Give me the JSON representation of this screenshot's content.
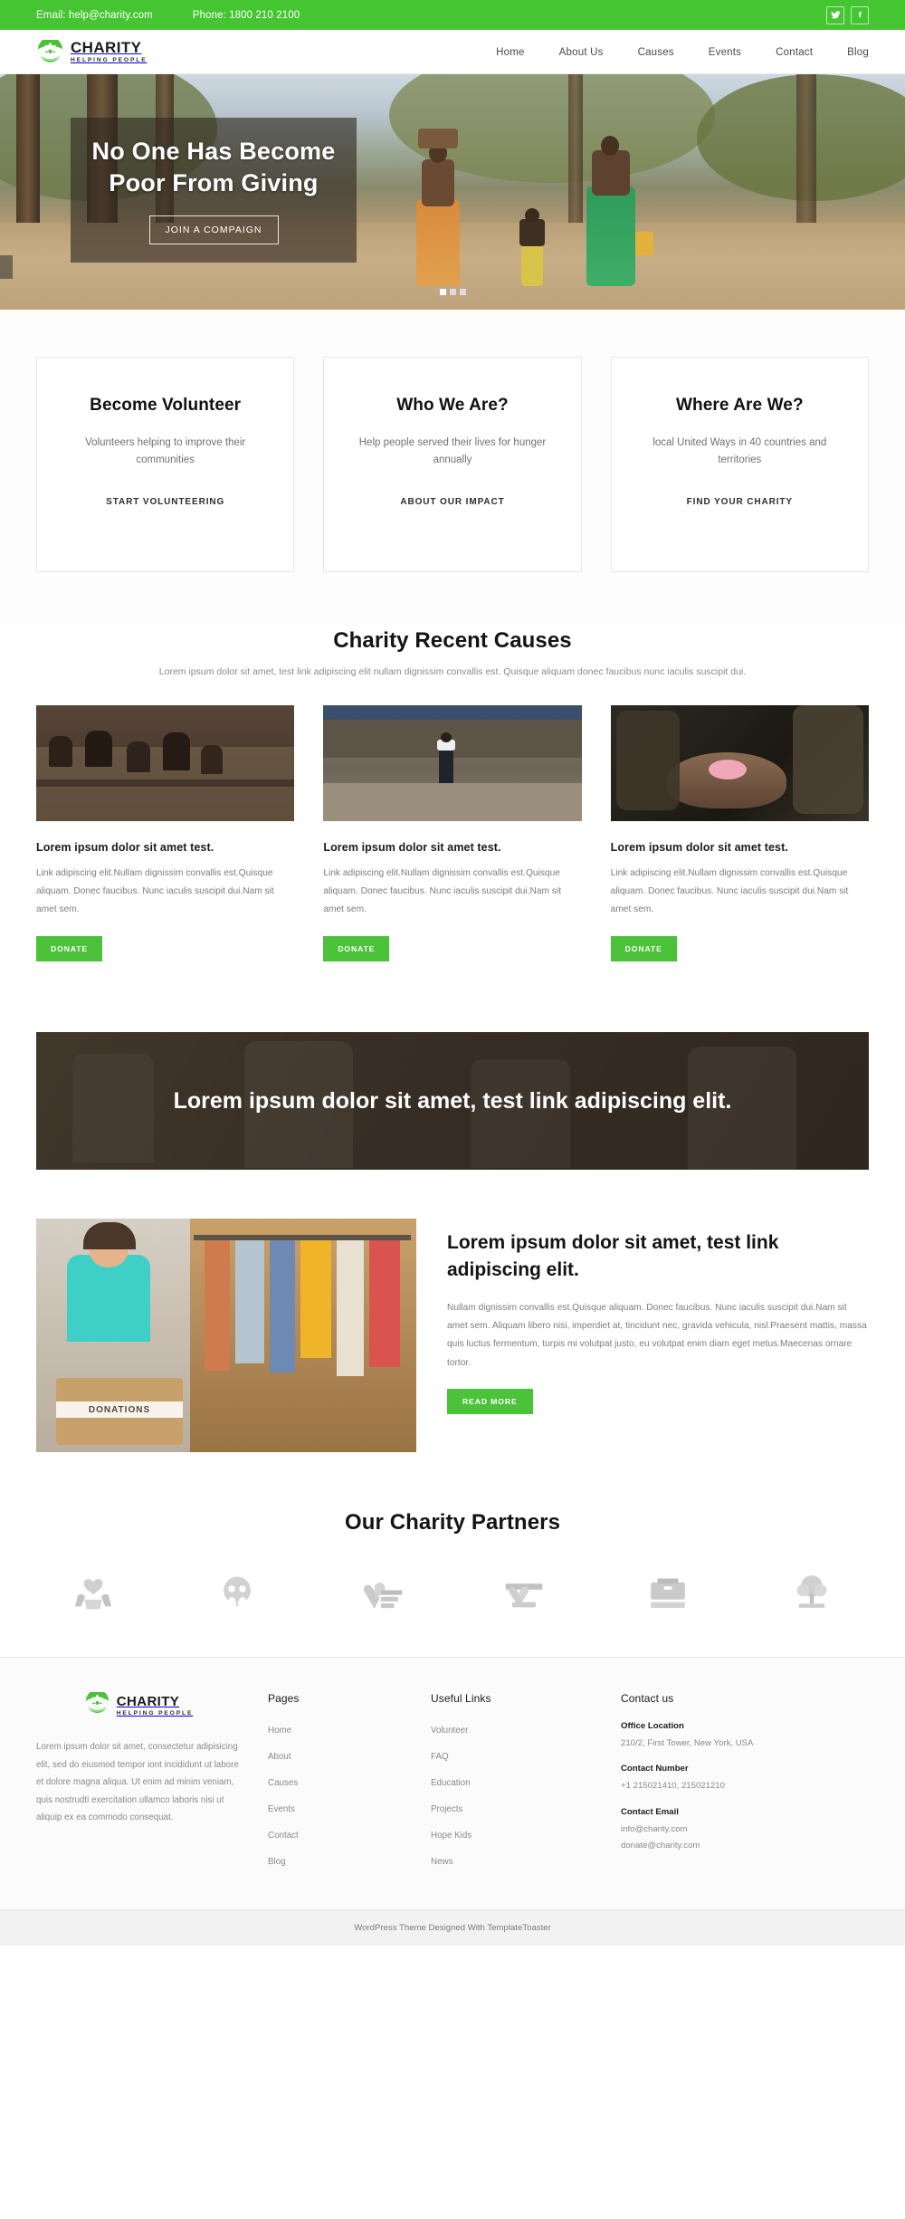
{
  "topbar": {
    "email": "Email: help@charity.com",
    "phone": "Phone: 1800 210 2100",
    "social": [
      {
        "name": "twitter-icon",
        "label": "Twitter"
      },
      {
        "name": "facebook-icon",
        "label": "Facebook"
      }
    ]
  },
  "brand": {
    "title": "CHARITY",
    "subtitle": "HELPING PEOPLE",
    "accent_color": "#4cc13a",
    "dark_color": "#1a1a1a"
  },
  "nav": {
    "items": [
      {
        "label": "Home"
      },
      {
        "label": "About Us"
      },
      {
        "label": "Causes"
      },
      {
        "label": "Events"
      },
      {
        "label": "Contact"
      },
      {
        "label": "Blog"
      }
    ]
  },
  "hero": {
    "headline": "No One Has Become Poor From Giving",
    "button": "JOIN A COMPAIGN",
    "slides": 3,
    "active_slide": 1
  },
  "features": [
    {
      "title": "Become Volunteer",
      "text": "Volunteers helping to improve their communities",
      "link": "START VOLUNTEERING"
    },
    {
      "title": "Who We Are?",
      "text": "Help people served their lives for hunger annually",
      "link": "ABOUT OUR IMPACT"
    },
    {
      "title": "Where Are We?",
      "text": "local United Ways in 40 countries and territories",
      "link": "FIND YOUR CHARITY"
    }
  ],
  "causes_section": {
    "title": "Charity Recent Causes",
    "subtitle": "Lorem ipsum dolor sit amet, test link adipiscing elit nullam dignissim convallis est. Quisque aliquam donec faucibus nunc iaculis suscipit dui.",
    "cards": [
      {
        "title": "Lorem ipsum dolor sit amet test.",
        "text": "Link adipiscing elit.Nullam dignissim convallis est.Quisque aliquam. Donec faucibus. Nunc iaculis suscipit dui.Nam sit amet sem.",
        "button": "DONATE"
      },
      {
        "title": "Lorem ipsum dolor sit amet test.",
        "text": "Link adipiscing elit.Nullam dignissim convallis est.Quisque aliquam. Donec faucibus. Nunc iaculis suscipit dui.Nam sit amet sem.",
        "button": "DONATE"
      },
      {
        "title": "Lorem ipsum dolor sit amet test.",
        "text": "Link adipiscing elit.Nullam dignissim convallis est.Quisque aliquam. Donec faucibus. Nunc iaculis suscipit dui.Nam sit amet sem.",
        "button": "DONATE"
      }
    ]
  },
  "banner": {
    "text": "Lorem ipsum dolor sit amet, test link adipiscing elit."
  },
  "about": {
    "title": "Lorem ipsum dolor sit amet, test link adipiscing elit.",
    "text": "Nullam dignissim convallis est.Quisque aliquam. Donec faucibus. Nunc iaculis suscipit dui.Nam sit amet sem. Aliquam libero nisi, imperdiet at, tincidunt nec, gravida vehicula, nisl.Praesent mattis, massa quis luctus fermentum, turpis mi volutpat justo, eu volutpat enim diam eget metus.Maecenas ornare tortor.",
    "button": "READ MORE",
    "image_caption": "DONATIONS"
  },
  "partners": {
    "title": "Our Charity Partners",
    "logos": [
      {
        "name": "partner-hands-heart-logo",
        "caption": ""
      },
      {
        "name": "partner-family-heart-logo",
        "caption": ""
      },
      {
        "name": "partner-you-can-help-logo",
        "caption": "YOU CAN HELP"
      },
      {
        "name": "partner-you-can-help-hands-logo",
        "caption": "YOU CAN HELP"
      },
      {
        "name": "partner-donate-box-logo",
        "caption": "DONATE"
      },
      {
        "name": "partner-tree-logo",
        "caption": ""
      }
    ]
  },
  "footer": {
    "about_text": "Lorem ipsum dolor sit amet, consectetur adipisicing elit, sed do eiusmod tempor iont incididunt ut labore et dolore magna aliqua. Ut enim ad minim veniam, quis nostrudti exercitation ullamco laboris nisi ut aliquip ex ea commodo consequat.",
    "pages": {
      "heading": "Pages",
      "items": [
        {
          "label": "Home"
        },
        {
          "label": "About"
        },
        {
          "label": "Causes"
        },
        {
          "label": "Events"
        },
        {
          "label": "Contact"
        },
        {
          "label": "Blog"
        }
      ]
    },
    "useful": {
      "heading": "Useful Links",
      "items": [
        {
          "label": "Volunteer"
        },
        {
          "label": "FAQ"
        },
        {
          "label": "Education"
        },
        {
          "label": "Projects"
        },
        {
          "label": "Hope Kids"
        },
        {
          "label": "News"
        }
      ]
    },
    "contact": {
      "heading": "Contact us",
      "office_label": "Office Location",
      "office_value": "210/2, First Tower, New York, USA",
      "number_label": "Contact Number",
      "number_value": "+1 215021410, 215021210",
      "email_label": "Contact Email",
      "email_value_1": "info@charity.com",
      "email_value_2": "donate@charity.com"
    },
    "copyright": "WordPress Theme Designed With TemplateToaster"
  }
}
